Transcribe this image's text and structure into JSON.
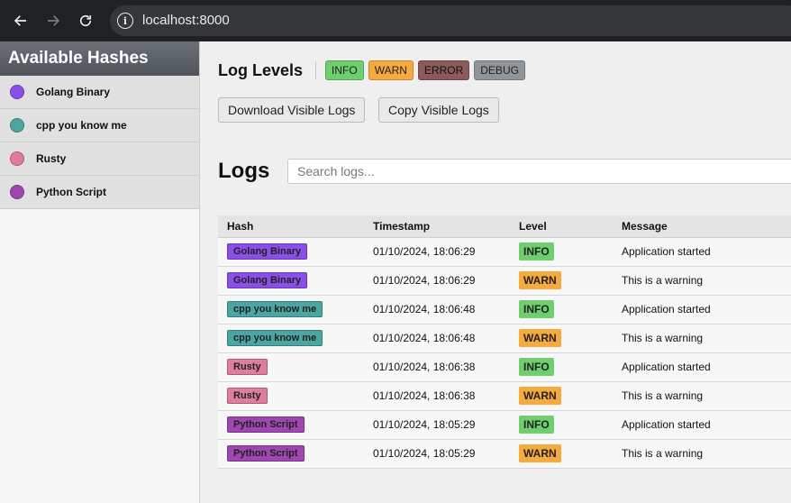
{
  "browser": {
    "url": "localhost:8000"
  },
  "sidebar": {
    "title": "Available Hashes",
    "items": [
      {
        "label": "Golang Binary",
        "color": "#8a4fe8"
      },
      {
        "label": "cpp you know me",
        "color": "#4aa6a0"
      },
      {
        "label": "Rusty",
        "color": "#e07c9c"
      },
      {
        "label": "Python Script",
        "color": "#9e47b0"
      }
    ]
  },
  "levels": {
    "title": "Log Levels",
    "chips": [
      "INFO",
      "WARN",
      "ERROR",
      "DEBUG"
    ]
  },
  "actions": {
    "download_label": "Download Visible Logs",
    "copy_label": "Copy Visible Logs"
  },
  "logs": {
    "title": "Logs",
    "search_placeholder": "Search logs...",
    "columns": [
      "Hash",
      "Timestamp",
      "Level",
      "Message"
    ],
    "rows": [
      {
        "hash": "Golang Binary",
        "timestamp": "01/10/2024, 18:06:29",
        "level": "INFO",
        "message": "Application started"
      },
      {
        "hash": "Golang Binary",
        "timestamp": "01/10/2024, 18:06:29",
        "level": "WARN",
        "message": "This is a warning"
      },
      {
        "hash": "cpp you know me",
        "timestamp": "01/10/2024, 18:06:48",
        "level": "INFO",
        "message": "Application started"
      },
      {
        "hash": "cpp you know me",
        "timestamp": "01/10/2024, 18:06:48",
        "level": "WARN",
        "message": "This is a warning"
      },
      {
        "hash": "Rusty",
        "timestamp": "01/10/2024, 18:06:38",
        "level": "INFO",
        "message": "Application started"
      },
      {
        "hash": "Rusty",
        "timestamp": "01/10/2024, 18:06:38",
        "level": "WARN",
        "message": "This is a warning"
      },
      {
        "hash": "Python Script",
        "timestamp": "01/10/2024, 18:05:29",
        "level": "INFO",
        "message": "Application started"
      },
      {
        "hash": "Python Script",
        "timestamp": "01/10/2024, 18:05:29",
        "level": "WARN",
        "message": "This is a warning"
      }
    ]
  },
  "colors": {
    "info": "#6fcf6f",
    "warn": "#f5a93f",
    "error": "#8c5a5a",
    "debug": "#8f9599"
  }
}
